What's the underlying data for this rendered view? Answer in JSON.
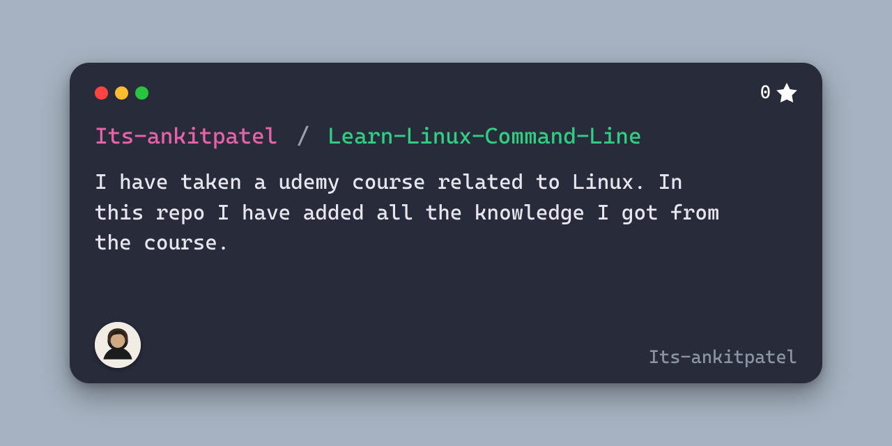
{
  "stars": {
    "count": "0"
  },
  "title": {
    "owner": "Its-ankitpatel",
    "separator": "/",
    "repo": "Learn-Linux-Command-Line"
  },
  "description": "I have taken a udemy course related to Linux. In this repo I have added all the knowledge I got from the course.",
  "footer": {
    "handle": "Its-ankitpatel"
  }
}
